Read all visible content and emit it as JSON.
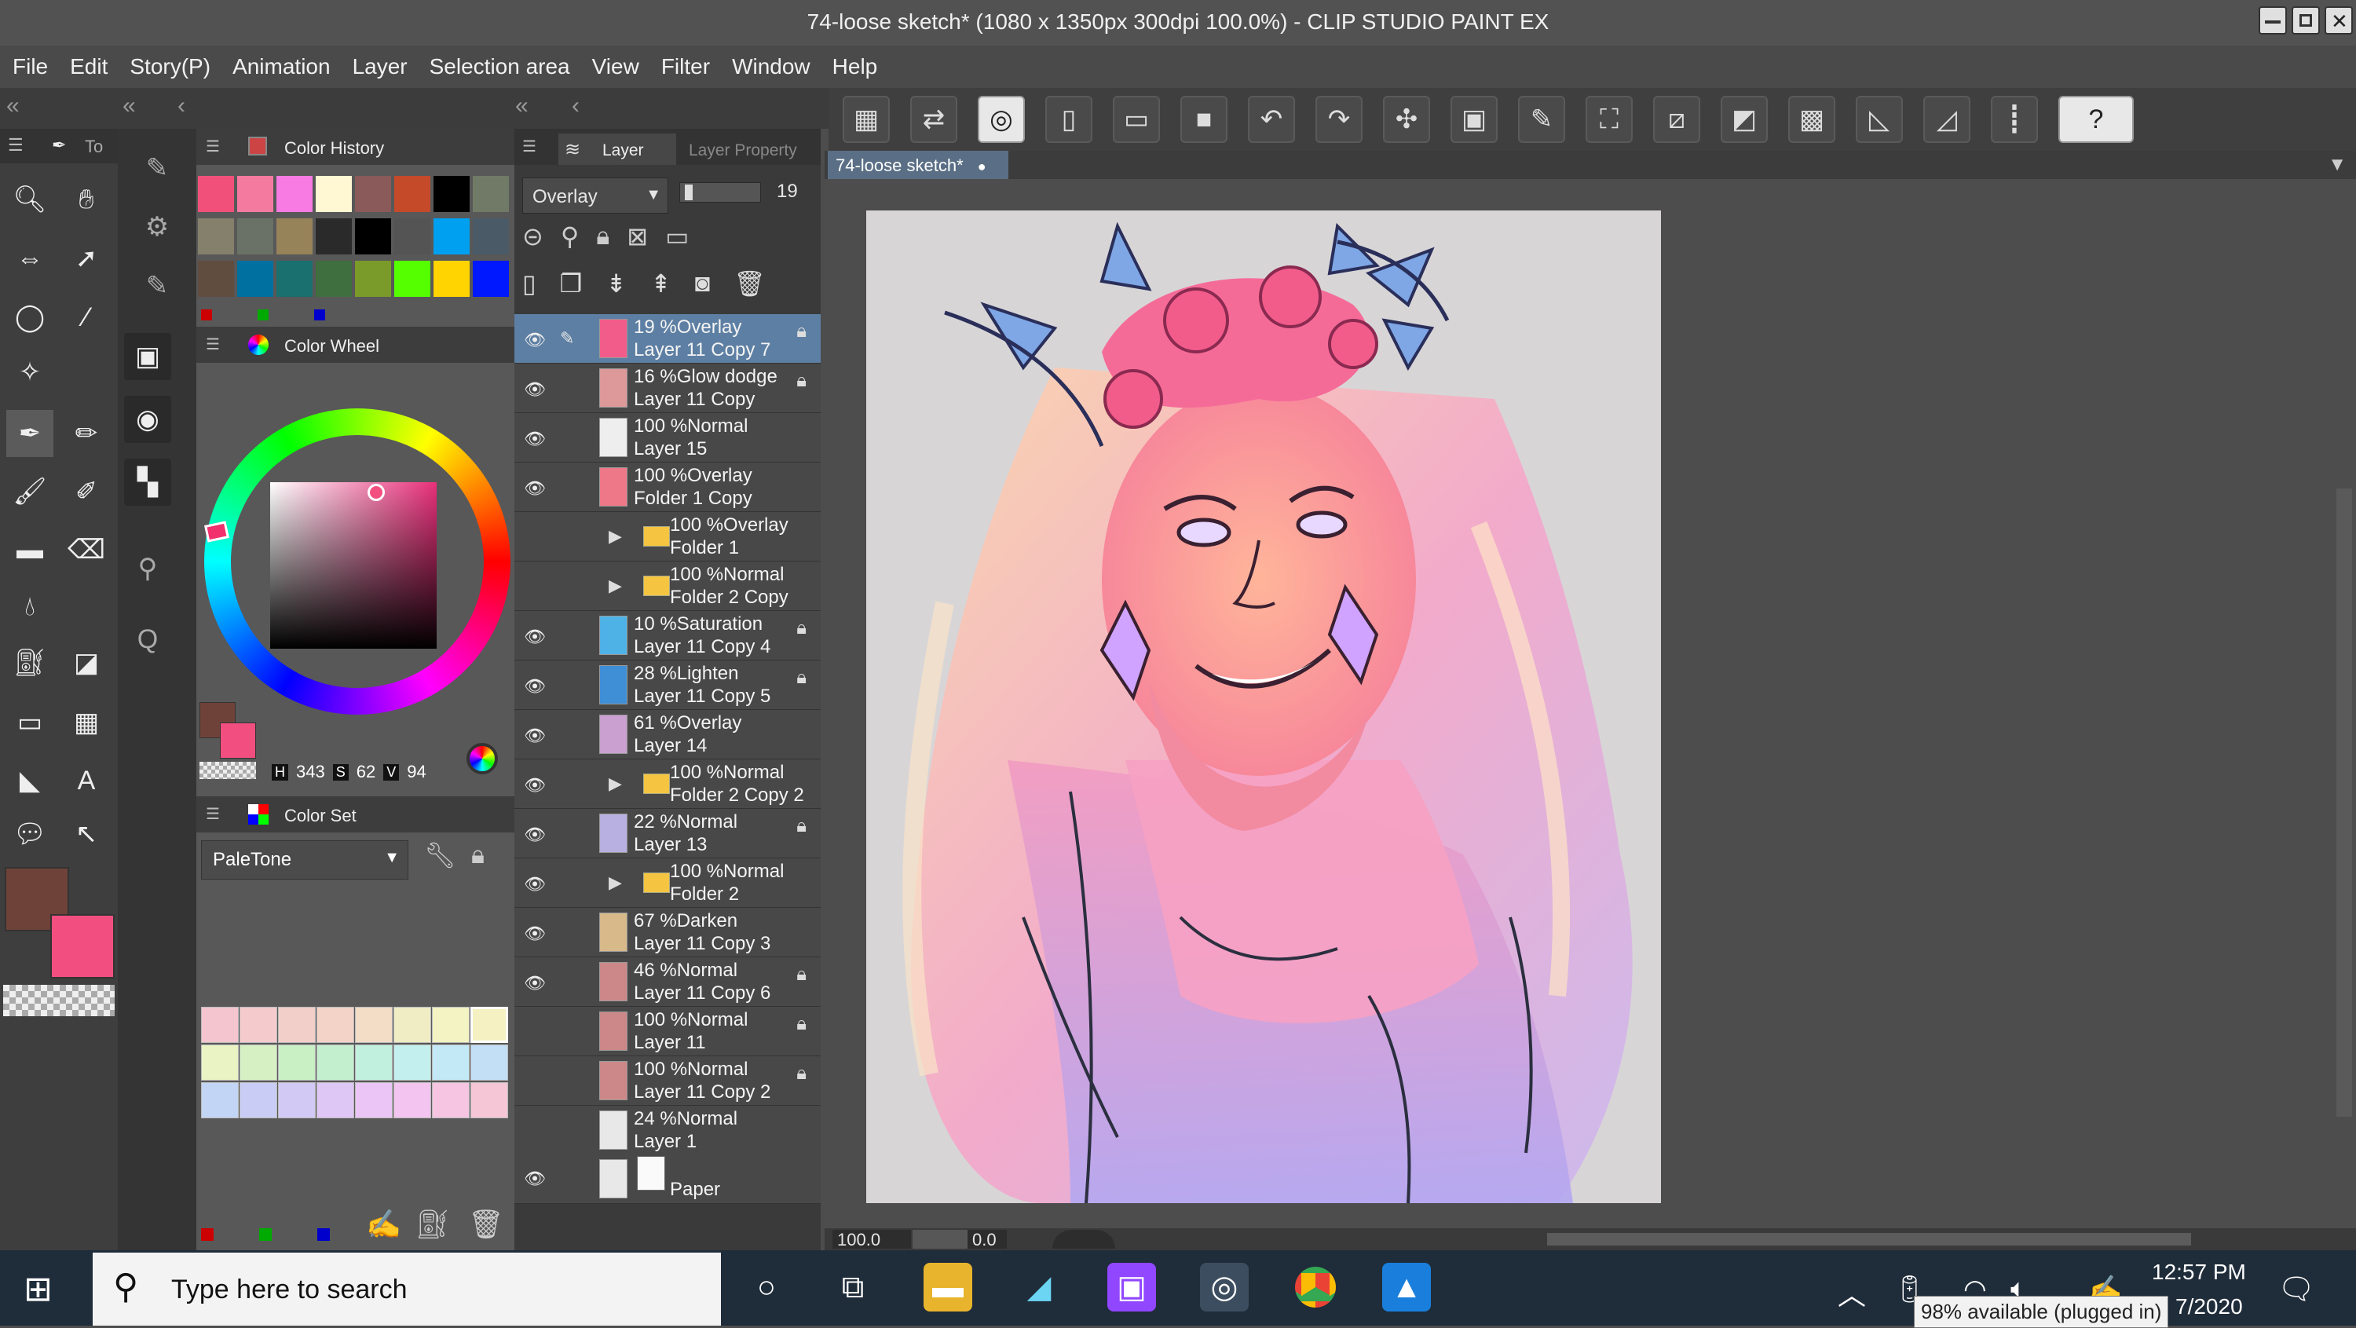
{
  "window": {
    "title": "74-loose sketch* (1080 x 1350px 300dpi 100.0%)  - CLIP STUDIO PAINT EX"
  },
  "menu": [
    "File",
    "Edit",
    "Story(P)",
    "Animation",
    "Layer",
    "Selection area",
    "View",
    "Filter",
    "Window",
    "Help"
  ],
  "tool_tab": "To",
  "color_history": {
    "title": "Color History",
    "swatches": [
      "#f0507a",
      "#f57aa0",
      "#f77be2",
      "#fff8d2",
      "#8a5a5a",
      "#c44a2a",
      "#000000",
      "#707a66",
      "#85806b",
      "#6a7166",
      "#97835a",
      "#2a2a2a",
      "#000000",
      "#545454",
      "#00a0f0",
      "#4a5a66",
      "#604d40",
      "#0070a0",
      "#1a6f6f",
      "#3f6f3f",
      "#7a9a2a",
      "#55ff00",
      "#ffd400",
      "#0018ff"
    ]
  },
  "color_wheel": {
    "title": "Color Wheel",
    "h_label": "H",
    "h": "343",
    "s_label": "S",
    "s": "62",
    "v_label": "V",
    "v": "94",
    "main_color": "#6f4239",
    "sub_color": "#f24f80"
  },
  "color_set": {
    "title": "Color Set",
    "set_name": "PaleTone",
    "swatches": [
      "#f5c5cf",
      "#f5cacd",
      "#f3cfc9",
      "#f3d3c7",
      "#f3ddc6",
      "#f0ecc3",
      "#f3f3c3",
      "#f5f1c2",
      "#e9f3c4",
      "#d6f0c3",
      "#c9efc5",
      "#c3efcf",
      "#c2f0de",
      "#c3f0ee",
      "#c2e9f5",
      "#c2dff5",
      "#c3d5f5",
      "#c9cdf5",
      "#d2c9f5",
      "#dec6f5",
      "#ebc5f5",
      "#f3c4ef",
      "#f5c5e2",
      "#f5c6d6"
    ]
  },
  "layer_panel": {
    "tab_layer": "Layer",
    "tab_property": "Layer Property",
    "blend_mode": "Overlay",
    "opacity": "19"
  },
  "layers": [
    {
      "pct": "19 %",
      "mode": "Overlay",
      "name": "Layer 11 Copy 7",
      "visible": true,
      "type": "layer",
      "selected": true
    },
    {
      "pct": "16 %",
      "mode": "Glow dodge",
      "name": "Layer 11 Copy",
      "visible": true,
      "type": "layer"
    },
    {
      "pct": "100 %",
      "mode": "Normal",
      "name": "Layer 15",
      "visible": true,
      "type": "layer"
    },
    {
      "pct": "100 %",
      "mode": "Overlay",
      "name": "Folder 1 Copy",
      "visible": true,
      "type": "layer"
    },
    {
      "pct": "100 %",
      "mode": "Overlay",
      "name": "Folder 1",
      "visible": false,
      "type": "folder"
    },
    {
      "pct": "100 %",
      "mode": "Normal",
      "name": "Folder 2 Copy",
      "visible": false,
      "type": "folder"
    },
    {
      "pct": "10 %",
      "mode": "Saturation",
      "name": "Layer 11 Copy 4",
      "visible": true,
      "type": "layer"
    },
    {
      "pct": "28 %",
      "mode": "Lighten",
      "name": "Layer 11 Copy 5",
      "visible": true,
      "type": "layer"
    },
    {
      "pct": "61 %",
      "mode": "Overlay",
      "name": "Layer 14",
      "visible": true,
      "type": "layer"
    },
    {
      "pct": "100 %",
      "mode": "Normal",
      "name": "Folder 2 Copy 2",
      "visible": true,
      "type": "folder"
    },
    {
      "pct": "22 %",
      "mode": "Normal",
      "name": "Layer 13",
      "visible": true,
      "type": "layer"
    },
    {
      "pct": "100 %",
      "mode": "Normal",
      "name": "Folder 2",
      "visible": true,
      "type": "folder"
    },
    {
      "pct": "67 %",
      "mode": "Darken",
      "name": "Layer 11 Copy 3",
      "visible": true,
      "type": "layer"
    },
    {
      "pct": "46 %",
      "mode": "Normal",
      "name": "Layer 11 Copy 6",
      "visible": true,
      "type": "layer"
    },
    {
      "pct": "100 %",
      "mode": "Normal",
      "name": "Layer 11",
      "visible": false,
      "type": "layer"
    },
    {
      "pct": "100 %",
      "mode": "Normal",
      "name": "Layer 11 Copy 2",
      "visible": false,
      "type": "layer"
    },
    {
      "pct": "24 %",
      "mode": "Normal",
      "name": "Layer 1",
      "visible": false,
      "type": "layer"
    }
  ],
  "paper_layer": "Paper",
  "canvas": {
    "tab": "74-loose sketch*",
    "zoom": "100.0",
    "rotation": "0.0"
  },
  "taskbar": {
    "search_placeholder": "Type here to search",
    "time": "12:57 PM",
    "date": "7/2020",
    "battery_tooltip": "98% available (plugged in)"
  }
}
